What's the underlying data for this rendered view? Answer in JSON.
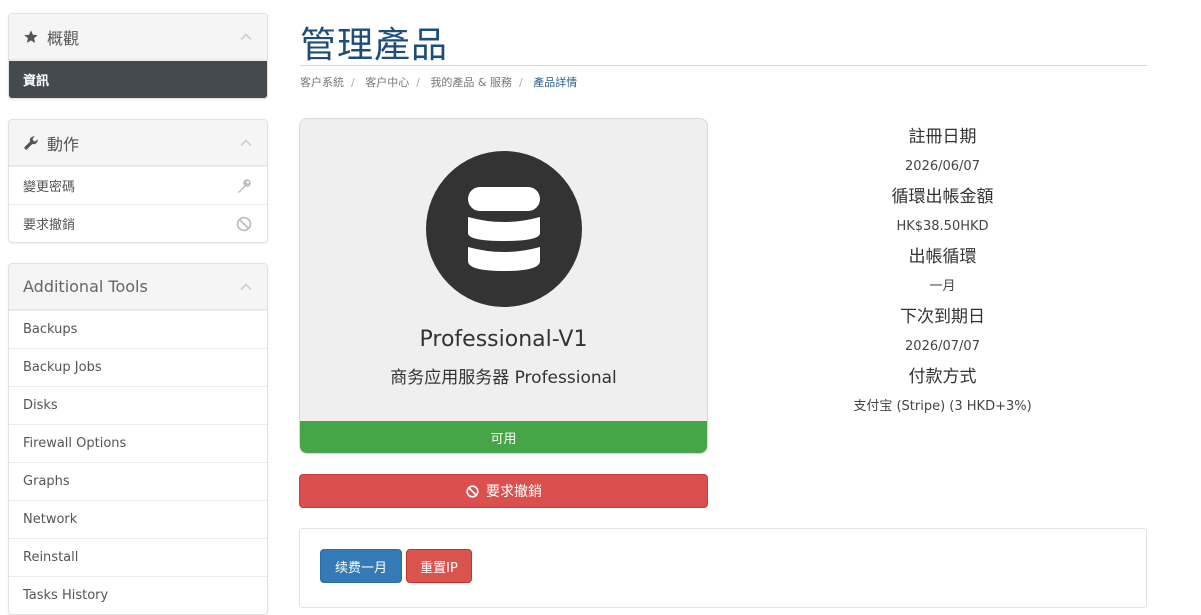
{
  "sidebar": {
    "overview": {
      "title": "概觀",
      "icon": "star-icon",
      "items": [
        {
          "label": "資訊"
        }
      ]
    },
    "actions": {
      "title": "動作",
      "icon": "wrench-icon",
      "items": [
        {
          "label": "變更密碼",
          "icon": "key-icon"
        },
        {
          "label": "要求撤銷",
          "icon": "ban-icon"
        }
      ]
    },
    "tools": {
      "title": "Additional Tools",
      "items": [
        {
          "label": "Backups"
        },
        {
          "label": "Backup Jobs"
        },
        {
          "label": "Disks"
        },
        {
          "label": "Firewall Options"
        },
        {
          "label": "Graphs"
        },
        {
          "label": "Network"
        },
        {
          "label": "Reinstall"
        },
        {
          "label": "Tasks History"
        }
      ]
    }
  },
  "page": {
    "title": "管理產品",
    "breadcrumb": [
      "客户系統",
      "客户中心",
      "我的產品 & 服務",
      "產品詳情"
    ]
  },
  "product": {
    "icon": "database-icon",
    "name": "Professional-V1",
    "group": "商务应用服务器 Professional",
    "status": "可用",
    "cancel_label": "要求撤銷"
  },
  "details": [
    {
      "label": "註冊日期",
      "value": "2026/06/07"
    },
    {
      "label": "循環出帳金額",
      "value": "HK$38.50HKD"
    },
    {
      "label": "出帳循環",
      "value": "一月"
    },
    {
      "label": "下次到期日",
      "value": "2026/07/07"
    },
    {
      "label": "付款方式",
      "value": "支付宝 (Stripe) (3 HKD+3%)"
    }
  ],
  "buttons": {
    "renew": "续费一月",
    "reset_ip": "重置IP"
  },
  "colors": {
    "title": "#1d4e79",
    "sidebar_active": "#454a4f",
    "status_green": "#46a546",
    "danger_red": "#dc4f4f",
    "primary_blue": "#337ab7"
  }
}
